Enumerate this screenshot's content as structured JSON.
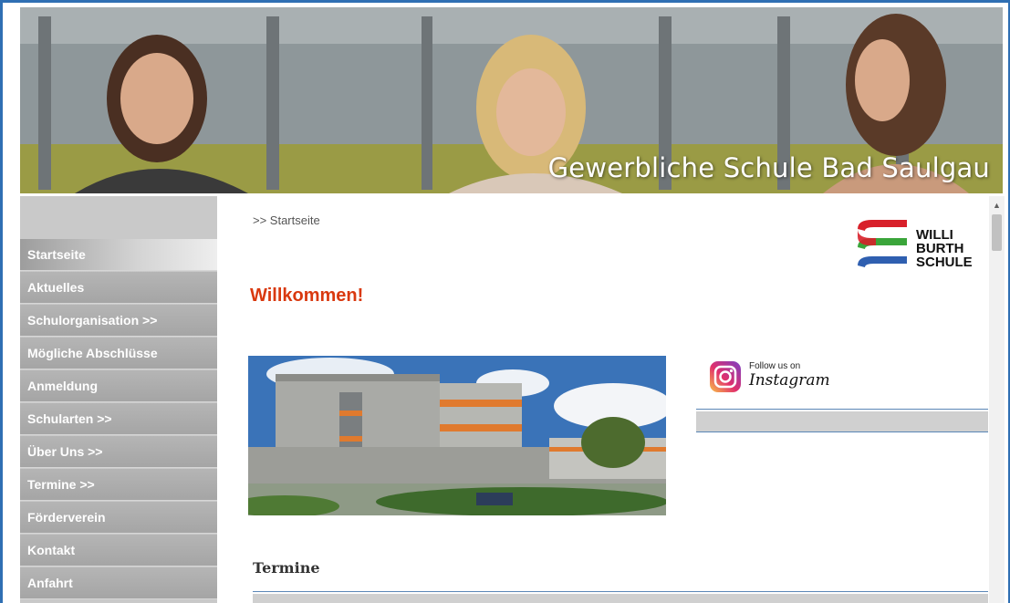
{
  "banner": {
    "title": "Gewerbliche Schule Bad Saulgau"
  },
  "sidebar": {
    "items": [
      {
        "label": "Startseite",
        "active": true
      },
      {
        "label": "Aktuelles"
      },
      {
        "label": "Schulorganisation >>"
      },
      {
        "label": "Mögliche Abschlüsse"
      },
      {
        "label": "Anmeldung"
      },
      {
        "label": "Schularten >>"
      },
      {
        "label": "Über Uns >>"
      },
      {
        "label": "Termine >>"
      },
      {
        "label": "Förderverein"
      },
      {
        "label": "Kontakt"
      },
      {
        "label": "Anfahrt"
      }
    ]
  },
  "breadcrumb": ">> Startseite",
  "logo": {
    "line1": "WILLI",
    "line2": "BURTH",
    "line3": "SCHULE"
  },
  "main": {
    "welcome": "Willkommen!"
  },
  "instagram": {
    "follow": "Follow us on",
    "name": "Instagram"
  },
  "termine": {
    "title": "Termine"
  },
  "colors": {
    "accent": "#d9390f",
    "sidebar": "#a9a9a9",
    "frame": "#2f6fb3",
    "logo_red": "#d8202a",
    "logo_green": "#3aa53a",
    "logo_blue": "#2f5fb0"
  },
  "icons": [
    "instagram-icon",
    "chevron-up-icon"
  ]
}
